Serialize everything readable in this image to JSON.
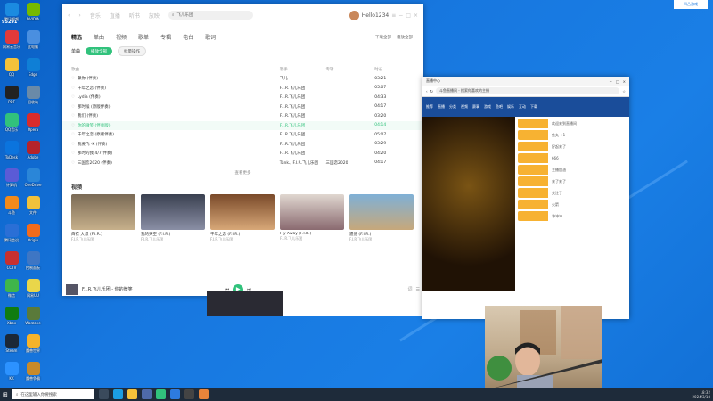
{
  "desktop": {
    "icons": [
      {
        "label": "腾讯视频"
      },
      {
        "label": "网易云音乐"
      },
      {
        "label": "QQ"
      },
      {
        "label": "PDF"
      },
      {
        "label": "QQ音乐"
      },
      {
        "label": "ToDesk"
      },
      {
        "label": "计算机"
      },
      {
        "label": "斗鱼"
      },
      {
        "label": "腾讯会议"
      },
      {
        "label": "CCTV"
      },
      {
        "label": "微信"
      },
      {
        "label": "Xbox"
      },
      {
        "label": "Steam"
      },
      {
        "label": "KK"
      },
      {
        "label": "NVIDIA"
      },
      {
        "label": "此电脑"
      },
      {
        "label": "Edge"
      },
      {
        "label": "回收站"
      },
      {
        "label": "Opera"
      },
      {
        "label": "Adobe"
      },
      {
        "label": "OneDrive"
      },
      {
        "label": "文件"
      },
      {
        "label": "Origin"
      },
      {
        "label": "控制面板"
      },
      {
        "label": "网易UU"
      },
      {
        "label": "Warzone"
      },
      {
        "label": "魔兽世界"
      },
      {
        "label": "魔兽争霸"
      }
    ],
    "top_badge": "95291",
    "corner_app_label": "凹凸游戏"
  },
  "music": {
    "nav": [
      "音乐",
      "直播",
      "听书",
      "放映"
    ],
    "search_value": "飞儿乐团",
    "user_name": "Hello1234",
    "tabs": [
      "精选",
      "单曲",
      "视频",
      "歌单",
      "专辑",
      "电台",
      "歌词"
    ],
    "actions": [
      "下载全部",
      "播放全部"
    ],
    "sub_label": "单曲",
    "play_all": "播放全部",
    "batch": "批量操作",
    "cols": [
      "歌曲",
      "歌手",
      "专辑",
      "时长"
    ],
    "songs": [
      {
        "title": "飘你 (伴奏)",
        "artist": "飞儿",
        "album": "",
        "dur": "03:21"
      },
      {
        "title": "千年之恋 (伴奏)",
        "artist": "F.I.R.飞儿乐团",
        "album": "",
        "dur": "05:07"
      },
      {
        "title": "Lydia (伴奏)",
        "artist": "F.I.R.飞儿乐团",
        "album": "",
        "dur": "04:33"
      },
      {
        "title": "那时候 (原版伴奏)",
        "artist": "F.I.R.飞儿乐团",
        "album": "",
        "dur": "04:17"
      },
      {
        "title": "我们 (伴奏)",
        "artist": "F.I.R.飞儿乐团",
        "album": "",
        "dur": "03:20"
      },
      {
        "title": "你的微笑 (伴奏版)",
        "artist": "F.I.R.飞儿乐团",
        "album": "",
        "dur": "04:14"
      },
      {
        "title": "千年之恋 (原版伴奏)",
        "artist": "F.I.R.飞儿乐团",
        "album": "",
        "dur": "05:07"
      },
      {
        "title": "我要飞 ·K (伴奏)",
        "artist": "F.I.R.飞儿乐团",
        "album": "",
        "dur": "03:29"
      },
      {
        "title": "那时的我 4/7(伴奏)",
        "artist": "F.I.R.飞儿乐团",
        "album": "",
        "dur": "04:20"
      },
      {
        "title": "三国恋2020 (伴奏)",
        "artist": "Tank、F.I.R.飞儿乐团",
        "album": "三国恋2020",
        "dur": "04:17"
      }
    ],
    "more": "查看更多",
    "videos_title": "视频",
    "videos": [
      {
        "title": "白衣 大叔 (F.I.R.)",
        "sub": "F.I.R.飞儿乐团"
      },
      {
        "title": "我的天空 (F.I.R.)",
        "sub": "F.I.R.飞儿乐团"
      },
      {
        "title": "千年之恋 (F.I.R.)",
        "sub": "F.I.R.飞儿乐团"
      },
      {
        "title": "Fly Away (F.I.R.)",
        "sub": "F.I.R.飞儿乐团"
      },
      {
        "title": "遗憾 (F.I.R.)",
        "sub": "F.I.R.飞儿乐团"
      }
    ],
    "now_playing": "F.I.R.飞儿乐团 - 你的微笑"
  },
  "browser": {
    "tab_title": "直播中心",
    "url": "斗鱼直播间 - 搜索你喜欢的主播",
    "nav": [
      "推荐",
      "直播",
      "分类",
      "视频",
      "赛事",
      "游戏",
      "鱼吧",
      "娱乐",
      "互动",
      "下载"
    ],
    "chat": [
      "欢迎来到直播间",
      "鱼丸 +1",
      "好起来了",
      "666",
      "主播加油",
      "来了来了",
      "关注了",
      "火箭",
      "冲冲冲"
    ]
  },
  "taskbar": {
    "search_placeholder": "在这里输入你要搜索",
    "time": "18:32",
    "date": "2024/3/18"
  },
  "colors": {
    "accent": "#31c27c",
    "desktop": "#1777df",
    "taskbar": "#1e2b3a"
  }
}
